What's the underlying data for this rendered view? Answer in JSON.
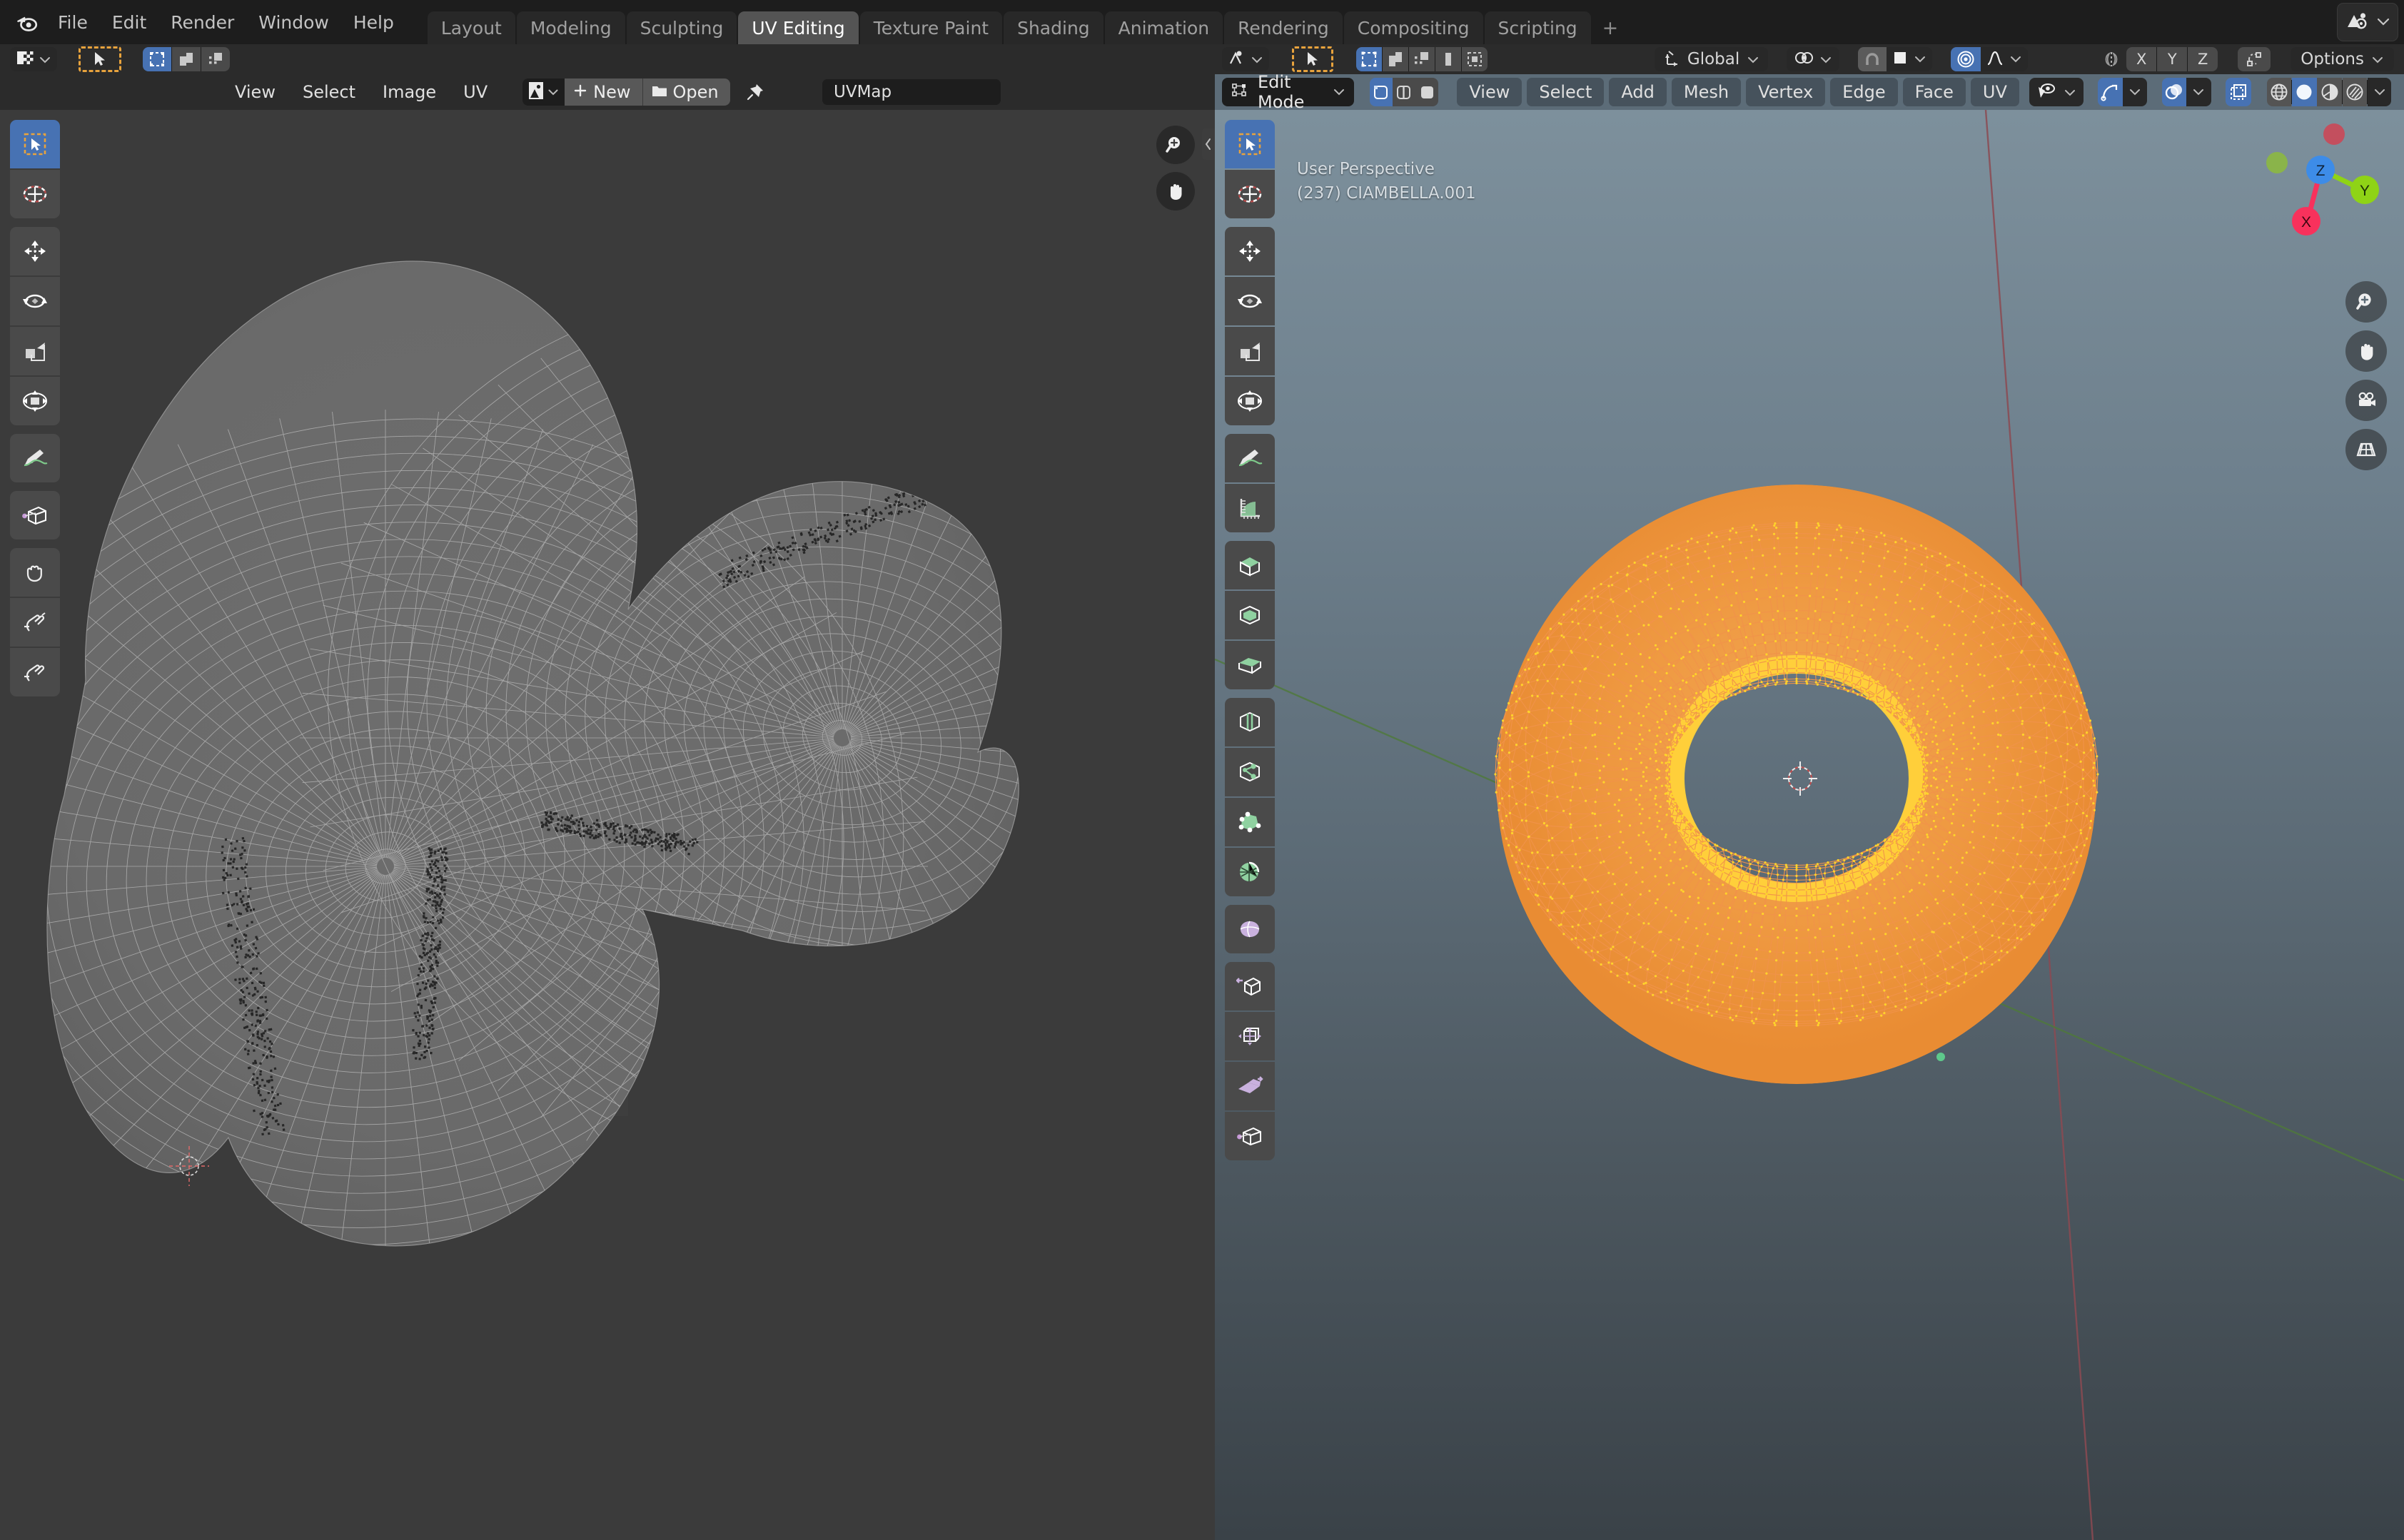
{
  "app": {
    "logo_icon": "blender-logo-icon"
  },
  "topbar": {
    "menus": [
      "File",
      "Edit",
      "Render",
      "Window",
      "Help"
    ],
    "workspace_tabs": [
      {
        "label": "Layout",
        "active": false
      },
      {
        "label": "Modeling",
        "active": false
      },
      {
        "label": "Sculpting",
        "active": false
      },
      {
        "label": "UV Editing",
        "active": true
      },
      {
        "label": "Texture Paint",
        "active": false
      },
      {
        "label": "Shading",
        "active": false
      },
      {
        "label": "Animation",
        "active": false
      },
      {
        "label": "Rendering",
        "active": false
      },
      {
        "label": "Compositing",
        "active": false
      },
      {
        "label": "Scripting",
        "active": false
      }
    ],
    "add_workspace_label": "+",
    "scene_icon": "scene-icon",
    "scene_dropdown_icon": "chevron-down-icon"
  },
  "uv_editor": {
    "editor_type_icon": "uv-editor-icon",
    "editor_type_chevron": "chevron-down-icon",
    "cursor_tool_icon": "tweak-cursor-icon",
    "uv_select_modes": [
      {
        "name": "vertex-select-icon",
        "active": true
      },
      {
        "name": "edge-select-icon",
        "active": false
      },
      {
        "name": "face-select-icon",
        "active": false
      }
    ],
    "menus": [
      "View",
      "Select",
      "Image",
      "UV"
    ],
    "image_browse_icon": "image-browse-icon",
    "image_browse_chevron": "chevron-down-icon",
    "new_label": "New",
    "new_icon": "plus-icon",
    "open_label": "Open",
    "open_icon": "folder-icon",
    "pin_icon": "pin-icon",
    "uvmap_value": "UVMap",
    "toolbar": [
      {
        "name": "tweak-tool",
        "icon": "cursor-arrow-icon",
        "selected": true
      },
      {
        "name": "cursor-tool",
        "icon": "3d-cursor-icon",
        "selected": false
      },
      {
        "name": "move-tool",
        "icon": "move-arrows-icon",
        "selected": false
      },
      {
        "name": "rotate-tool",
        "icon": "rotate-icon",
        "selected": false
      },
      {
        "name": "scale-tool",
        "icon": "scale-icon",
        "selected": false
      },
      {
        "name": "transform-tool",
        "icon": "transform-icon",
        "selected": false
      },
      {
        "name": "annotate-tool",
        "icon": "pencil-icon",
        "selected": false
      },
      {
        "name": "rip-region-tool",
        "icon": "rip-region-icon",
        "selected": false
      },
      {
        "name": "grab-tool",
        "icon": "grab-hand-icon",
        "selected": false
      },
      {
        "name": "relax-tool",
        "icon": "relax-hand-icon",
        "selected": false
      },
      {
        "name": "pinch-tool",
        "icon": "pinch-hand-icon",
        "selected": false
      }
    ],
    "nav_zoom_icon": "zoom-in-icon",
    "nav_pan_icon": "pan-hand-icon",
    "collapse_icon": "chevron-left-icon"
  },
  "view3d": {
    "editor_type_icon": "view3d-editor-icon",
    "editor_type_chevron": "chevron-down-icon",
    "cursor_tool_icon": "tweak-cursor-icon",
    "mesh_select_modes": [
      {
        "name": "vertex-select-icon",
        "active": true
      },
      {
        "name": "edge-select-icon",
        "active": false
      },
      {
        "name": "face-select-icon",
        "active": false
      },
      {
        "name": "extra-select-icon-1",
        "active": false
      },
      {
        "name": "extra-select-icon-2",
        "active": false
      }
    ],
    "transform_orientation": {
      "icon": "orientation-icon",
      "label": "Global",
      "chevron": "chevron-down-icon"
    },
    "pivot_icon": "pivot-point-icon",
    "pivot_chevron": "chevron-down-icon",
    "snap_magnet_icon": "magnet-icon",
    "snap_target_icon": "snap-increment-icon",
    "snap_chevron": "chevron-down-icon",
    "proportional_icon": "proportional-editing-icon",
    "proportional_on": true,
    "falloff_icon": "smooth-falloff-icon",
    "falloff_chevron": "chevron-down-icon",
    "mirror_icon": "mirror-icon",
    "mirror_axes": [
      "X",
      "Y",
      "Z"
    ],
    "topology_mirror_icon": "topology-mirror-icon",
    "options_label": "Options",
    "options_chevron": "chevron-down-icon",
    "mode_selector": {
      "icon": "edit-mode-icon",
      "label": "Edit Mode",
      "chevron": "chevron-down-icon"
    },
    "menus": [
      "View",
      "Select",
      "Add",
      "Mesh",
      "Vertex",
      "Edge",
      "Face",
      "UV"
    ],
    "visibility_icon": "eye-icon",
    "visibility_chevron": "chevron-down-icon",
    "gizmo_icon": "gizmo-icon",
    "gizmo_chevron": "chevron-down-icon",
    "overlays_icon": "overlays-icon",
    "overlays_chevron": "chevron-down-icon",
    "xray_icon": "xray-icon",
    "shading_modes": [
      {
        "name": "wireframe-shading-icon",
        "active": false
      },
      {
        "name": "solid-shading-icon",
        "active": true
      },
      {
        "name": "material-preview-shading-icon",
        "active": false
      },
      {
        "name": "rendered-shading-icon",
        "active": false
      }
    ],
    "shading_chevron": "chevron-down-icon",
    "overlay_text": {
      "line1": "User Perspective",
      "line2": "(237) CIAMBELLA.001"
    },
    "toolbar": [
      {
        "name": "tweak-tool",
        "icon": "cursor-arrow-icon",
        "selected": true
      },
      {
        "name": "cursor-tool",
        "icon": "3d-cursor-icon",
        "selected": false
      },
      {
        "name": "move-tool",
        "icon": "move-arrows-icon",
        "selected": false
      },
      {
        "name": "rotate-tool",
        "icon": "rotate-icon",
        "selected": false
      },
      {
        "name": "scale-tool",
        "icon": "scale-icon",
        "selected": false
      },
      {
        "name": "transform-tool",
        "icon": "transform-icon",
        "selected": false
      },
      {
        "name": "annotate-tool",
        "icon": "pencil-icon",
        "selected": false
      },
      {
        "name": "measure-tool",
        "icon": "ruler-icon",
        "selected": false
      },
      {
        "name": "add-cube-tool",
        "icon": "add-cube-icon",
        "selected": false
      },
      {
        "name": "extrude-region-tool",
        "icon": "extrude-region-icon",
        "selected": false
      },
      {
        "name": "inset-faces-tool",
        "icon": "inset-faces-icon",
        "selected": false
      },
      {
        "name": "bevel-tool",
        "icon": "bevel-icon",
        "selected": false
      },
      {
        "name": "loop-cut-tool",
        "icon": "loop-cut-icon",
        "selected": false
      },
      {
        "name": "knife-tool",
        "icon": "knife-icon",
        "selected": false
      },
      {
        "name": "poly-build-tool",
        "icon": "poly-build-icon",
        "selected": false
      },
      {
        "name": "spin-tool",
        "icon": "spin-icon",
        "selected": false
      },
      {
        "name": "smooth-tool",
        "icon": "smooth-icon",
        "selected": false
      },
      {
        "name": "edge-slide-tool",
        "icon": "edge-slide-icon",
        "selected": false
      },
      {
        "name": "shrink-fatten-tool",
        "icon": "shrink-fatten-icon",
        "selected": false
      },
      {
        "name": "shear-tool",
        "icon": "shear-icon",
        "selected": false
      },
      {
        "name": "rip-region-tool",
        "icon": "rip-region-icon",
        "selected": false
      }
    ],
    "nav_gizmo": {
      "axes": [
        {
          "label": "Z",
          "color": "#3d8ce8"
        },
        {
          "label": "Y",
          "color": "#8fd316"
        },
        {
          "label": "X",
          "color": "#f8315c"
        }
      ],
      "neg_axes": [
        {
          "label": "",
          "color": "#c34f5e"
        },
        {
          "label": "",
          "color": "#8ab44a"
        }
      ]
    },
    "nav_buttons": [
      {
        "name": "zoom-in-icon"
      },
      {
        "name": "pan-hand-icon"
      },
      {
        "name": "camera-view-icon"
      },
      {
        "name": "toggle-perspective-icon"
      }
    ]
  },
  "colors": {
    "accent_blue": "#4772b3",
    "mesh_edge_orange": "#f0924a",
    "mesh_vertex_yellow": "#ffd42a",
    "axis_x_red": "#b34a52",
    "axis_y_green": "#5a9a3c",
    "header_dark": "#2b2b2b",
    "header_blue": "#5c6c78",
    "uv_canvas_bg": "#3b3b3b",
    "uv_mesh_fill": "#6e6e6e"
  }
}
